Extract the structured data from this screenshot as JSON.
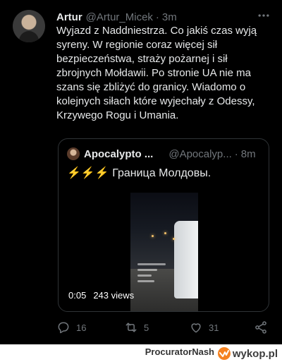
{
  "tweet": {
    "name": "Artur",
    "handle": "@Artur_Micek",
    "separator": "·",
    "time": "3m",
    "text": "Wyjazd z Naddniestrza. Co jakiś czas wyją syreny. W regionie coraz więcej sił bezpieczeństwa, straży pożarnej i sił zbrojnych Mołdawii. Po stronie UA nie ma szans się zbliżyć do granicy. Wiadomo o kolejnych siłach które wyjechały z Odessy, Krzywego Rogu i Umania.",
    "icons": {
      "avatar": "avatar",
      "more": "more-icon"
    }
  },
  "quote": {
    "name": "Apocalypto ...",
    "handle": "@Apocalyp...",
    "separator": "·",
    "time": "8m",
    "bolts": "⚡⚡⚡",
    "text": "Граница Молдовы.",
    "video": {
      "duration": "0:05",
      "views": "243 views"
    }
  },
  "actions": {
    "reply_count": "16",
    "retweet_count": "5",
    "like_count": "31",
    "icons": [
      "reply-icon",
      "retweet-icon",
      "like-icon",
      "share-icon"
    ]
  },
  "footer": {
    "user": "ProcuratorNash",
    "z": "z",
    "logo_text": "wykop.pl",
    "colors": {
      "wykop_accent": "#f58220"
    }
  },
  "colors": {
    "background": "#000000",
    "text_primary": "#e7e9ea",
    "text_secondary": "#71767b",
    "border": "#2f3336",
    "bolt": "#ffbf00"
  }
}
